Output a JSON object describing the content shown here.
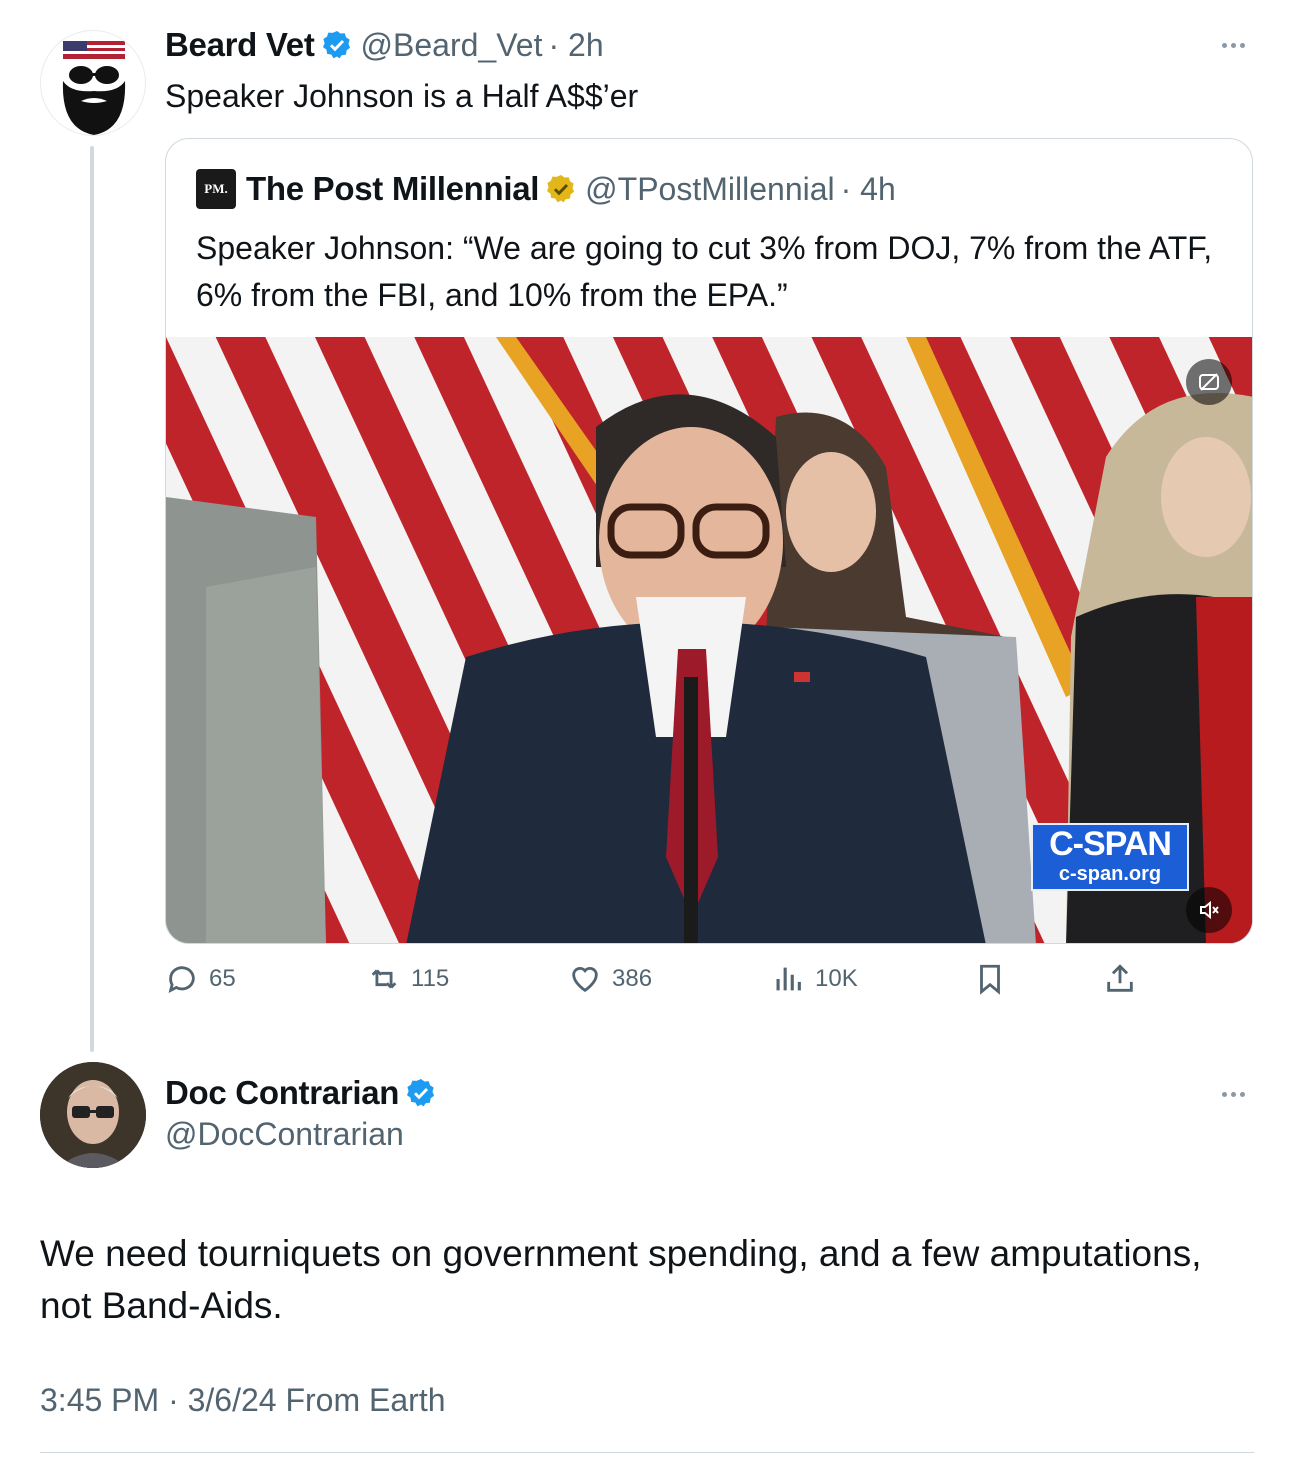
{
  "tweet1": {
    "name": "Beard Vet",
    "handle": "@Beard_Vet",
    "time": "· 2h",
    "text": "Speaker Johnson is a Half A$$’er"
  },
  "quote": {
    "logo": "PM.",
    "name": "The Post Millennial",
    "handle": "@TPostMillennial",
    "time": "· 4h",
    "text": "Speaker Johnson: “We are going to cut 3% from DOJ, 7% from the ATF, 6% from the FBI, and 10% from the EPA.”",
    "video": {
      "watermark_title": "C-SPAN",
      "watermark_url": "c-span.org"
    }
  },
  "actions": {
    "replies": "65",
    "reposts": "115",
    "likes": "386",
    "views": "10K"
  },
  "tweet2": {
    "name": "Doc Contrarian",
    "handle": "@DocContrarian",
    "text": "We need tourniquets on government spending, and a few amputations, not Band-Aids.",
    "timestamp": "3:45 PM · 3/6/24 From Earth"
  },
  "colors": {
    "verified_blue": "#1d9bf0",
    "verified_gold": "#e2b719",
    "secondary_text": "#536471",
    "border": "#cfd9de"
  },
  "icons": [
    "more-icon",
    "verified-badge-icon",
    "gold-badge-icon",
    "reply-icon",
    "repost-icon",
    "like-icon",
    "views-icon",
    "bookmark-icon",
    "share-icon",
    "captions-icon",
    "mute-icon"
  ]
}
